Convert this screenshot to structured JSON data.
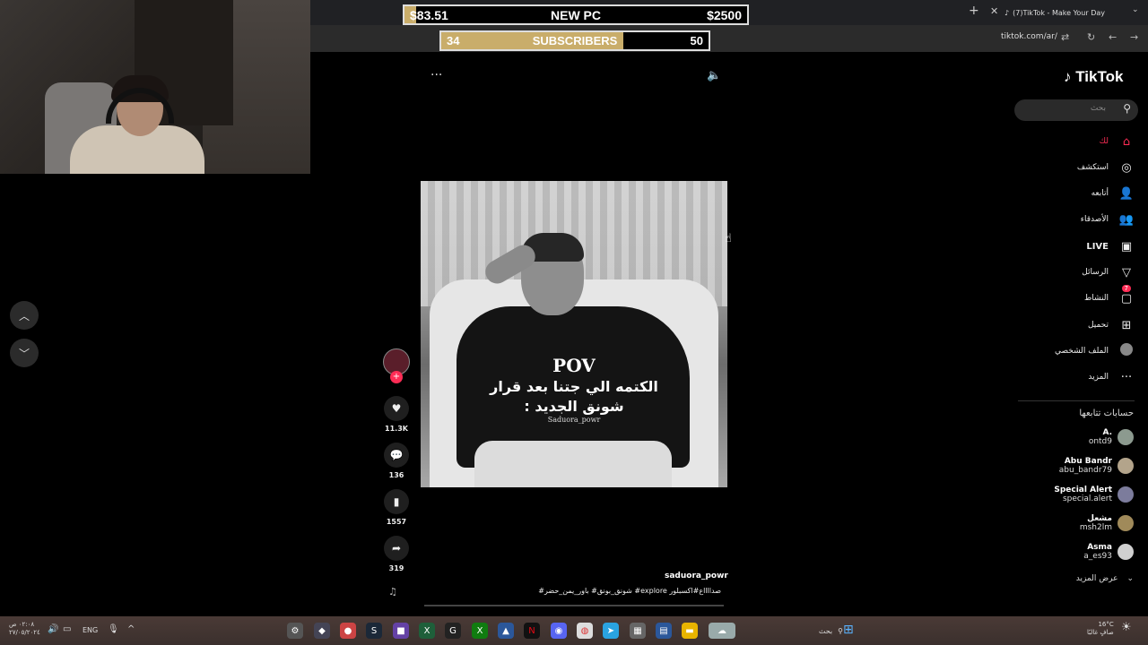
{
  "overlay": {
    "pc_goal": {
      "current": "$83.51",
      "label": "NEW PC",
      "target": "$2500",
      "progress": 0.033
    },
    "sub_goal": {
      "current": "34",
      "label": "SUBSCRIBERS",
      "target": "50",
      "progress": 0.68
    }
  },
  "browser": {
    "tab_title": "(7)TikTok - Make Your Day",
    "url": "tiktok.com/ar/"
  },
  "tiktok": {
    "logo": "TikTok",
    "search_placeholder": "بحث",
    "nav": [
      {
        "label": "لك",
        "icon": "home-icon",
        "active": true
      },
      {
        "label": "استكشف",
        "icon": "compass-icon"
      },
      {
        "label": "أتابعه",
        "icon": "user-check-icon"
      },
      {
        "label": "الأصدقاء",
        "icon": "friends-icon"
      },
      {
        "label": "LIVE",
        "icon": "live-icon"
      },
      {
        "label": "الرسائل",
        "icon": "send-icon"
      },
      {
        "label": "النشاط",
        "icon": "inbox-icon",
        "badge": "7"
      },
      {
        "label": "تحميل",
        "icon": "upload-icon"
      },
      {
        "label": "الملف الشخصي",
        "icon": "profile-avatar"
      },
      {
        "label": "المزيد",
        "icon": "more-icon"
      }
    ],
    "following_title": "حسابات تتابعها",
    "following": [
      {
        "name": "A.",
        "user": "ontd9"
      },
      {
        "name": "Abu Bandr",
        "user": "abu_bandr79"
      },
      {
        "name": "Special Alert",
        "user": "special.alert"
      },
      {
        "name": "مشعل",
        "user": "msh2lm"
      },
      {
        "name": "Asma",
        "user": "a_es93"
      }
    ],
    "show_more": "عرض المزيد",
    "video": {
      "title": "POV",
      "line1": "الكتمه الي جتنا بعد قرار",
      "line2": "شونق الجديد :",
      "watermark": "Saduora_powr"
    },
    "actions": {
      "likes": "11.3K",
      "comments": "136",
      "saves": "1557",
      "shares": "319"
    },
    "caption": {
      "user": "saduora_powr",
      "tags": "صدااااع#اكسبلور explore# شونق_بونق# باور_يمن_حضر#"
    }
  },
  "taskbar": {
    "time": "٠٢:٠٨ ص",
    "date": "٢٧/٠٥/٢٠٢٤",
    "lang": "ENG",
    "search": "بحث",
    "temp": "16°C",
    "weather": "صافٍ غالبًا"
  },
  "colors": {
    "accent": "#fe2c55",
    "goal_fill": "#c9ad6a"
  }
}
